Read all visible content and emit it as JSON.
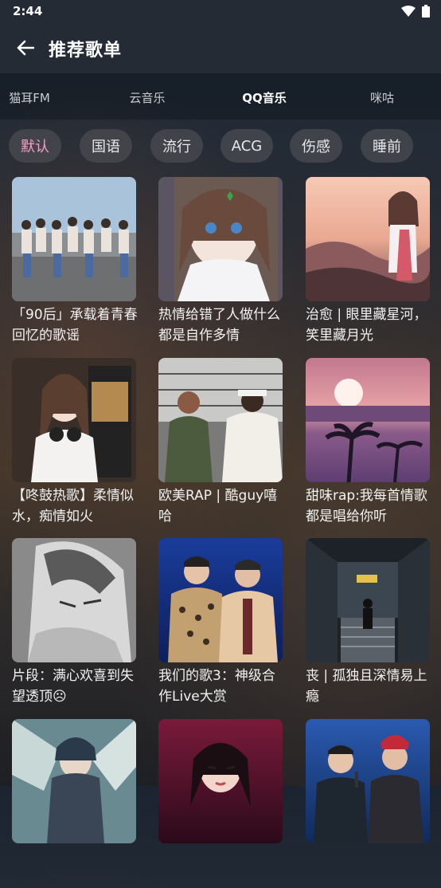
{
  "status": {
    "time": "2:44"
  },
  "header": {
    "title": "推荐歌单",
    "back_icon": "arrow-left-icon"
  },
  "sources": [
    {
      "label": "猫耳FM",
      "active": false
    },
    {
      "label": "云音乐",
      "active": false
    },
    {
      "label": "QQ音乐",
      "active": true
    },
    {
      "label": "咪咕",
      "active": false
    }
  ],
  "categories": [
    {
      "label": "默认",
      "active": true
    },
    {
      "label": "国语",
      "active": false
    },
    {
      "label": "流行",
      "active": false
    },
    {
      "label": "ACG",
      "active": false
    },
    {
      "label": "伤感",
      "active": false
    },
    {
      "label": "睡前",
      "active": false
    }
  ],
  "playlists": [
    {
      "title": "「90后」承载着青春回忆的歌谣"
    },
    {
      "title": "热情给错了人做什么都是自作多情"
    },
    {
      "title": "治愈 | 眼里藏星河，笑里藏月光"
    },
    {
      "title": "【咚鼓热歌】柔情似水，痴情如火"
    },
    {
      "title": "欧美RAP | 酷guy嘻哈"
    },
    {
      "title": "甜味rap:我每首情歌都是唱给你听"
    },
    {
      "title": "片段：满心欢喜到失望透顶☹"
    },
    {
      "title": "我们的歌3：神级合作Live大赏"
    },
    {
      "title": "丧 | 孤独且深情易上瘾"
    },
    {
      "title": ""
    },
    {
      "title": ""
    },
    {
      "title": ""
    }
  ],
  "colors": {
    "accent": "#f4a0c8",
    "appbar": "#242b35"
  }
}
